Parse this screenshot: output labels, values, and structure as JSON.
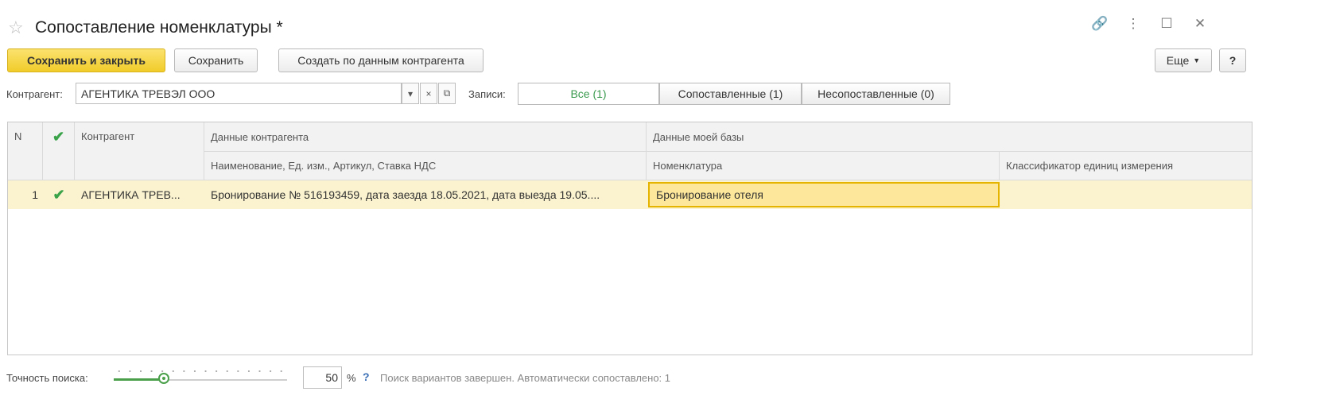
{
  "window": {
    "title": "Сопоставление номенклатуры *",
    "icons": [
      "link-icon",
      "more-icon",
      "maximize-icon",
      "close-icon"
    ]
  },
  "toolbar": {
    "save_close": "Сохранить и закрыть",
    "save": "Сохранить",
    "create_from_counterparty": "Создать по данным контрагента",
    "more": "Еще",
    "help": "?"
  },
  "filter": {
    "counterparty_label": "Контрагент:",
    "counterparty_value": "АГЕНТИКА ТРЕВЭЛ ООО",
    "records_label": "Записи:",
    "segments": [
      {
        "label": "Все (1)",
        "active": true
      },
      {
        "label": "Сопоставленные (1)",
        "active": false
      },
      {
        "label": "Несопоставленные (0)",
        "active": false
      }
    ]
  },
  "table": {
    "headers": {
      "n": "N",
      "counterparty": "Контрагент",
      "counterparty_data": "Данные контрагента",
      "counterparty_data_sub": "Наименование, Ед. изм., Артикул, Ставка НДС",
      "my_base": "Данные моей базы",
      "nomenclature": "Номенклатура",
      "unit_classifier": "Классификатор единиц измерения"
    },
    "rows": [
      {
        "n": "1",
        "counterparty": "АГЕНТИКА ТРЕВ...",
        "description": "Бронирование № 516193459, дата заезда 18.05.2021, дата выезда 19.05....",
        "nomenclature": "Бронирование отеля",
        "unit": ""
      }
    ]
  },
  "footer": {
    "accuracy_label": "Точность поиска:",
    "accuracy_value": "50",
    "accuracy_fraction": 0.29,
    "percent": "%",
    "help": "?",
    "status": "Поиск вариантов завершен. Автоматически сопоставлено: 1"
  },
  "colors": {
    "accent_yellow": "#f1cc2a",
    "check_green": "#3aa34a",
    "selected_row": "#fbf3cf"
  }
}
